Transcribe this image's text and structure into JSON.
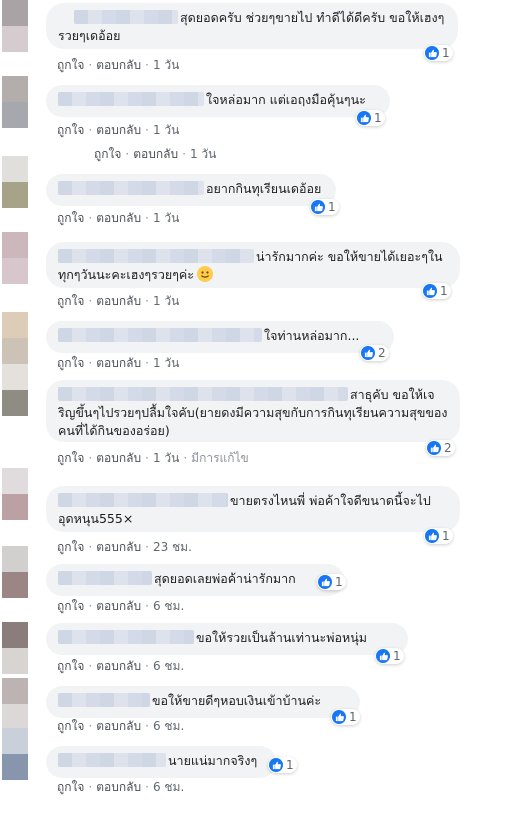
{
  "actions": {
    "like": "ถูกใจ",
    "reply": "ตอบกลับ",
    "separator": "·",
    "edited": "มีการแก้ไข"
  },
  "colors": {
    "bubble_bg": "#f2f3f5",
    "like_blue": "#1877f2",
    "meta_text": "#606770"
  },
  "comments": [
    {
      "text": "สุดยอดครับ ช่วยๆขายไป ทำดีได้ดีครับ ขอให้เฮงๆรวยๆเดอ้อย",
      "time": "1 วัน",
      "reactions": "1",
      "avatar_top": "#a9a3a5",
      "avatar_bottom": "#d6ccd0"
    },
    {
      "text": "ใจหล่อมาก แต่เอฤงมือคุ้นๆนะ",
      "time": "1 วัน",
      "reactions": "1",
      "avatar_top": "#b3aeab",
      "avatar_bottom": "#a6a8ad"
    },
    {
      "text": "อยากกินทุเรียนเดอ้อย",
      "time": "1 วัน",
      "reactions": "1",
      "avatar_top": "#e1dfdc",
      "avatar_bottom": "#a6a389"
    },
    {
      "text": "น่ารักมากค่ะ ขอให้ขายได้เยอะๆในทุกๆวันนะคะเฮงๆรวยๆค่ะ",
      "emoji": "smile-emoji-icon",
      "time": "1 วัน",
      "reactions": "1",
      "avatar_top": "#cbb7bc",
      "avatar_bottom": "#d7c6cb"
    },
    {
      "text": "ใจท่านหล่อมาก...",
      "time": "1 วัน",
      "reactions": "2",
      "avatar_top": "#dcccb8",
      "avatar_bottom": "#cdc2b6"
    },
    {
      "text": "สาธุคับ ขอให้เจริญขึ้นๆไปรวยๆปลื้มใจคับ(ยายดงมีความสุขกับการกินทุเรียนความสุขของคนที่ได้กินของอร่อย)",
      "time": "1 วัน",
      "edited": true,
      "reactions": "2",
      "avatar_top": "#e4e1dc",
      "avatar_bottom": "#8f8c83"
    },
    {
      "text": "ขายตรงไหนพี่ พ่อค้าใจดีขนาดนี้จะไปอุดหนุน555×",
      "time": "23 ชม.",
      "reactions": "1",
      "avatar_top": "#e0dbdc",
      "avatar_bottom": "#bca1a4"
    },
    {
      "text": "สุดยอดเลยพ่อค้าน่ารักมาก",
      "time": "6 ชม.",
      "reactions": "1",
      "avatar_top": "#d2cfcf",
      "avatar_bottom": "#9c8585"
    },
    {
      "text": "ขอให้รวยเป็นล้านเท่านะพ่อหนุ่ม",
      "time": "6 ชม.",
      "reactions": "1",
      "avatar_top": "#8a7d7b",
      "avatar_bottom": "#d8d4d2"
    },
    {
      "text": "ขอให้ขายดีๆหอบเงินเข้าบ้านค่ะ",
      "time": "6 ชม.",
      "reactions": "1",
      "avatar_top": "#bdb3b3",
      "avatar_bottom": "#ddd8d8"
    },
    {
      "text": "นายแน่มากจริงๆ",
      "time": "6 ชม.",
      "reactions": "1",
      "avatar_top": "#c9d0da",
      "avatar_bottom": "#8796ad"
    }
  ],
  "reply_meta": {
    "time": "1 วัน"
  }
}
